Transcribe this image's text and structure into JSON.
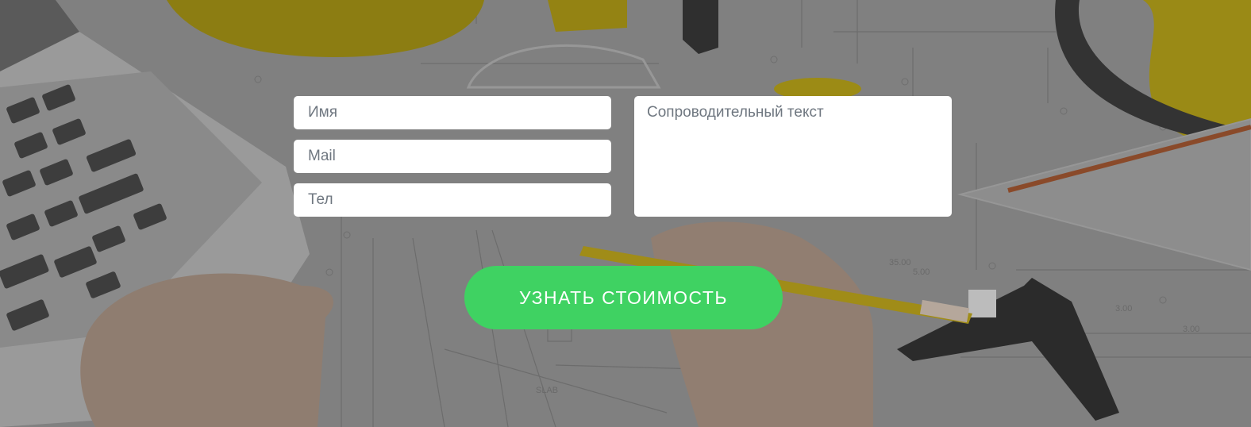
{
  "form": {
    "name_placeholder": "Имя",
    "mail_placeholder": "Mail",
    "phone_placeholder": "Тел",
    "message_placeholder": "Сопроводительный текст",
    "submit_label": "УЗНАТЬ СТОИМОСТЬ"
  },
  "colors": {
    "overlay": "#7d7d7d",
    "field_background": "#ffffff",
    "placeholder_text": "#6f7780",
    "submit_button": "#3fd262",
    "submit_text": "#ffffff"
  }
}
